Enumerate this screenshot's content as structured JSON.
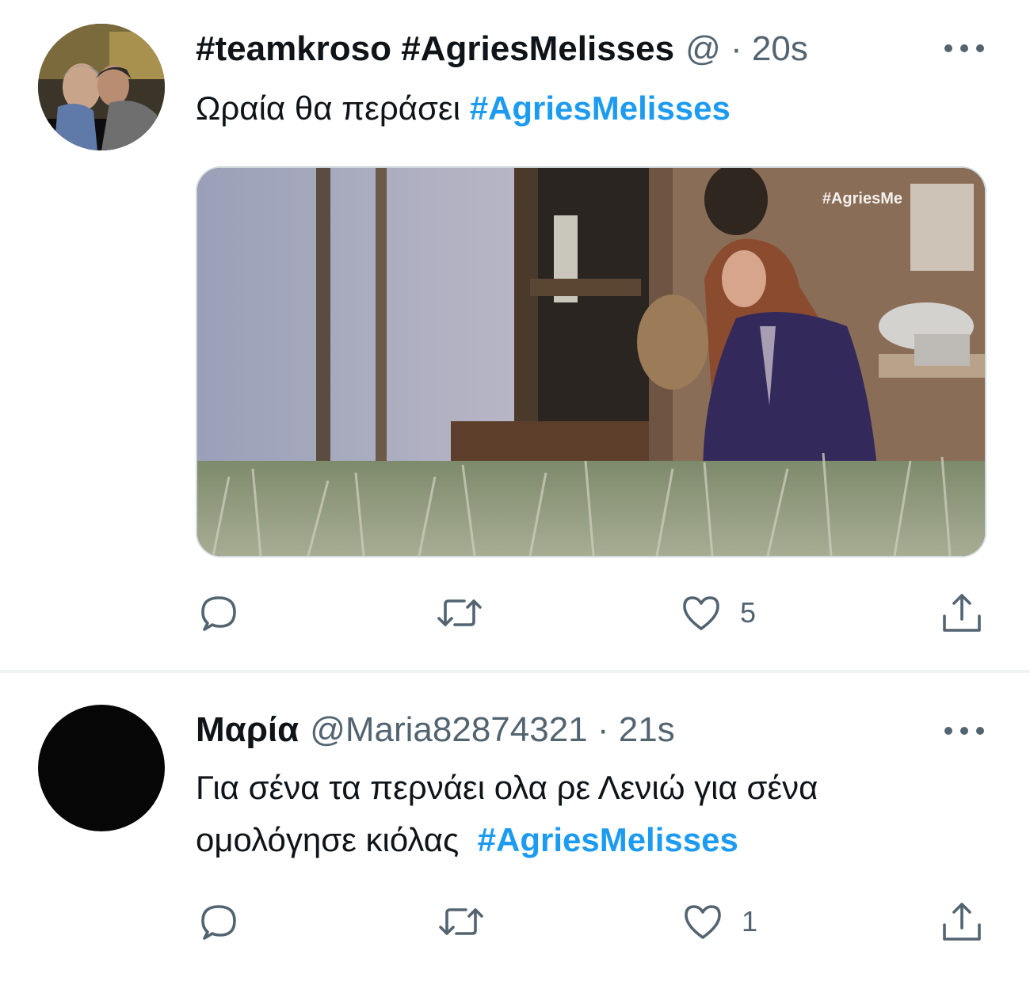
{
  "colors": {
    "link": "#1d9bf0",
    "secondary_text": "#536471",
    "primary_text": "#0f1419",
    "divider": "#eff3f4"
  },
  "tweets": [
    {
      "display_name": "#teamkroso #AgriesMelisses",
      "handle": "@",
      "separator": "·",
      "time": "20s",
      "text": "Ωραία θα περάσει",
      "hashtag": "#AgriesMelisses",
      "media_watermark": "#AgriesMe",
      "actions": {
        "reply_icon": "reply-icon",
        "retweet_icon": "retweet-icon",
        "like_icon": "heart-icon",
        "share_icon": "share-icon",
        "like_count": "5"
      }
    },
    {
      "display_name": "Μαρία",
      "handle": "@Maria82874321",
      "separator": "·",
      "time": "21s",
      "text_line1": "Για σένα τα περνάει ολα ρε Λενιώ για σένα",
      "text_line2": "ομολόγησε κιόλας",
      "hashtag": "#AgriesMelisses",
      "actions": {
        "reply_icon": "reply-icon",
        "retweet_icon": "retweet-icon",
        "like_icon": "heart-icon",
        "share_icon": "share-icon",
        "like_count": "1"
      }
    }
  ]
}
